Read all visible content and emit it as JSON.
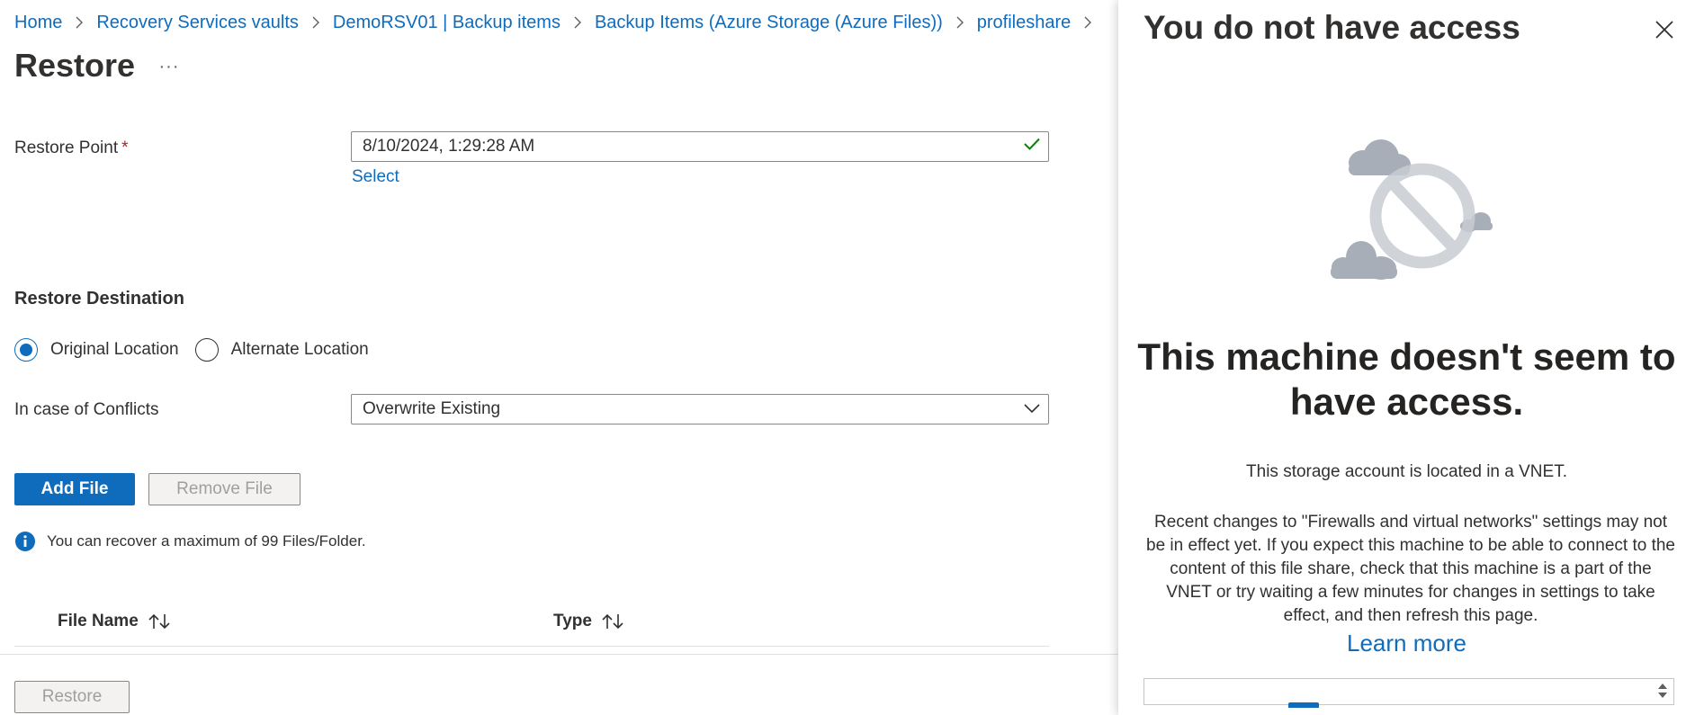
{
  "breadcrumb": [
    "Home",
    "Recovery Services vaults",
    "DemoRSV01 | Backup items",
    "Backup Items (Azure Storage (Azure Files))",
    "profileshare"
  ],
  "page": {
    "title": "Restore",
    "more": "···"
  },
  "restore_point": {
    "label": "Restore Point",
    "required": "*",
    "value": "8/10/2024, 1:29:28 AM",
    "select_link": "Select"
  },
  "destination": {
    "title": "Restore Destination",
    "options": [
      "Original Location",
      "Alternate Location"
    ],
    "selected": "Original Location"
  },
  "conflicts": {
    "label": "In case of Conflicts",
    "value": "Overwrite Existing"
  },
  "buttons": {
    "add_file": "Add File",
    "remove_file": "Remove File",
    "restore": "Restore"
  },
  "info": {
    "text": "You can recover a maximum of 99 Files/Folder."
  },
  "table": {
    "columns": [
      "File Name",
      "Type"
    ]
  },
  "panel": {
    "title": "You do not have access",
    "headline": "This machine doesn't seem to have access.",
    "subtext": "This storage account is located in a VNET.",
    "description": "Recent changes to \"Firewalls and virtual networks\" settings may not be in effect yet. If you expect this machine to be able to connect to the content of this file share, check that this machine is a part of the VNET or try waiting a few minutes for changes in settings to take effect, and then refresh this page.",
    "learn_more": "Learn more"
  },
  "icons": {
    "breadcrumb_separator": "chevron-right-icon",
    "valid": "checkmark-icon",
    "dropdown": "chevron-down-icon",
    "info": "info-icon",
    "sort": "sort-arrows-icon",
    "close": "close-icon",
    "illustration": "no-access-cloud-illustration"
  },
  "colors": {
    "accent": "#0f6cbd",
    "valid": "#107c10",
    "illustration": "#a8aeb8"
  }
}
